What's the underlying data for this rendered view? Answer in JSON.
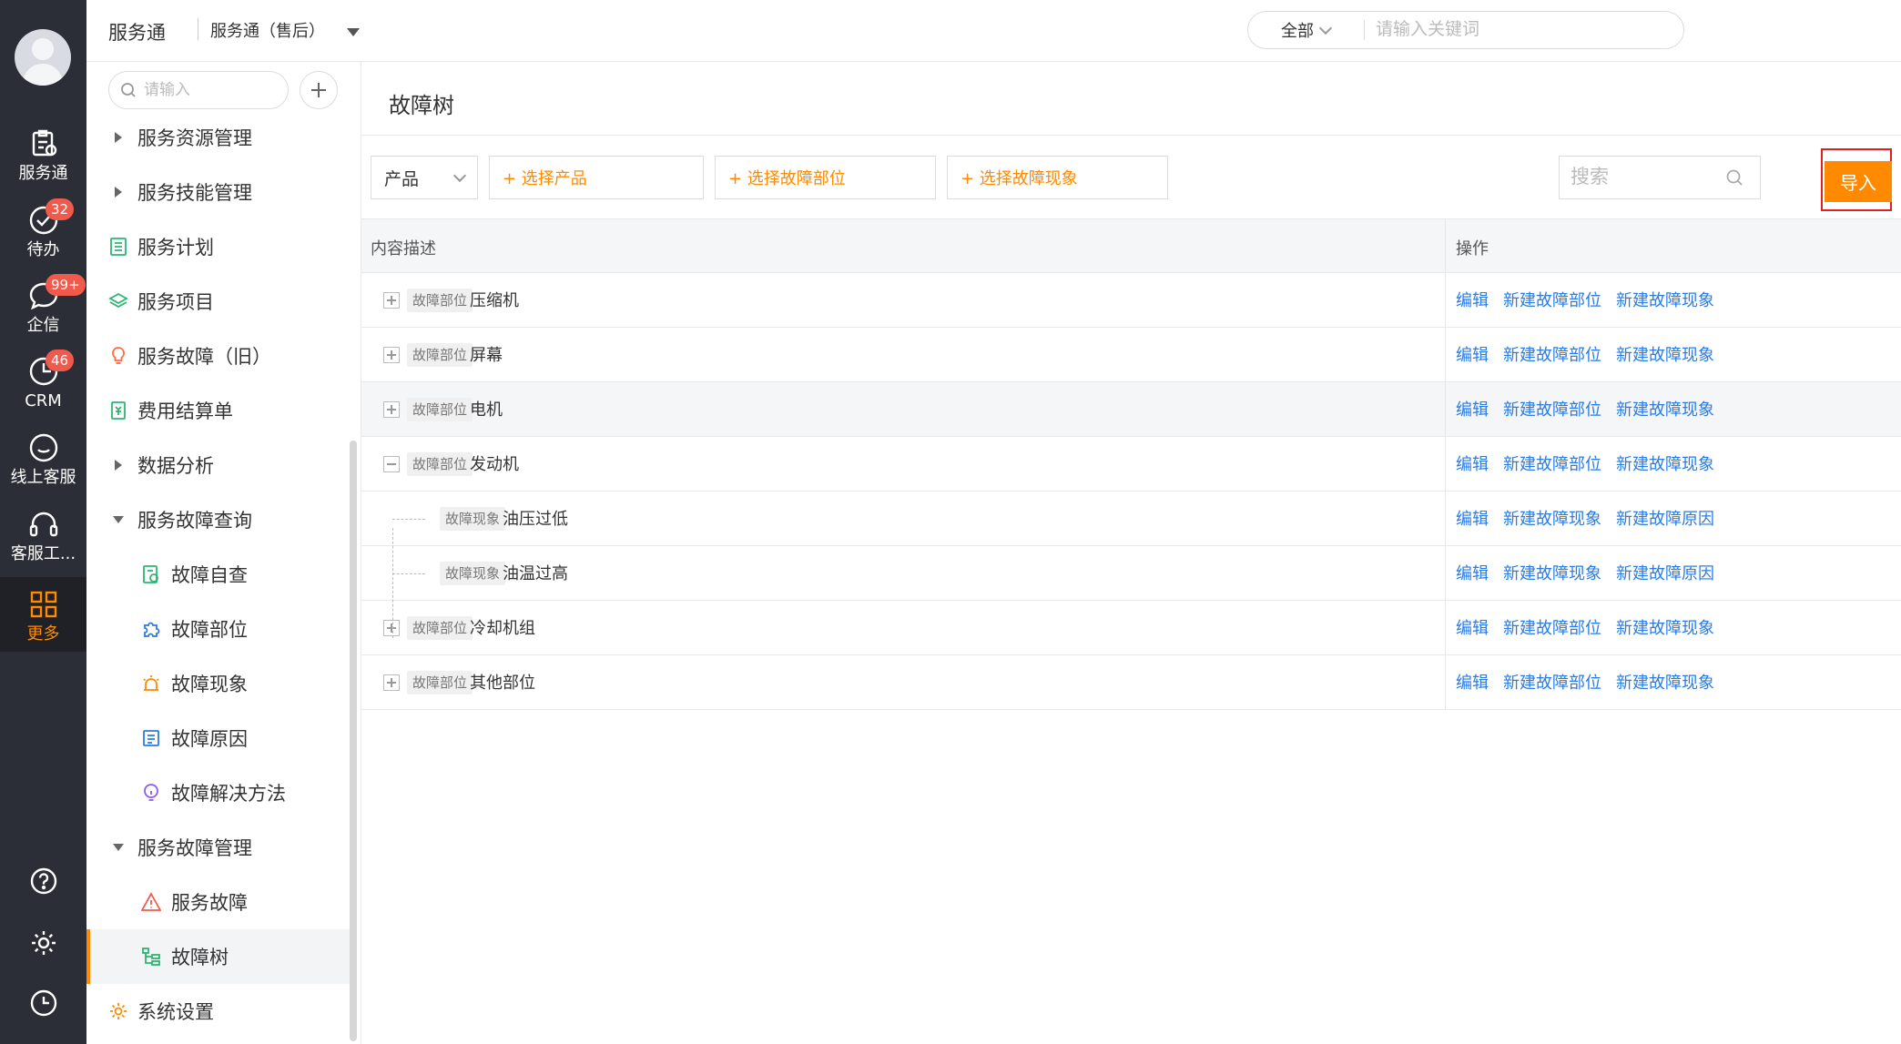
{
  "rail": {
    "items": [
      {
        "label": "服务通",
        "icon": "clipboard-icon"
      },
      {
        "label": "待办",
        "icon": "check-circle-icon",
        "badge": "32"
      },
      {
        "label": "企信",
        "icon": "chat-bubble-icon",
        "badge": "99+"
      },
      {
        "label": "CRM",
        "icon": "clock-chart-icon",
        "badge": "46"
      },
      {
        "label": "线上客服",
        "icon": "smile-chat-icon"
      },
      {
        "label": "客服工...",
        "icon": "headset-icon"
      },
      {
        "label": "更多",
        "icon": "grid-icon"
      }
    ],
    "bottom_icons": [
      "help-icon",
      "settings-icon",
      "history-icon"
    ]
  },
  "topbar": {
    "app_title": "服务通",
    "app_select": "服务通（售后）",
    "search_scope": "全部",
    "search_placeholder": "请输入关键词"
  },
  "subnav": {
    "search_placeholder": "请输入",
    "items": [
      {
        "label": "服务资源管理"
      },
      {
        "label": "服务技能管理"
      },
      {
        "label": "服务计划"
      },
      {
        "label": "服务项目"
      },
      {
        "label": "服务故障（旧）"
      },
      {
        "label": "费用结算单"
      },
      {
        "label": "数据分析"
      },
      {
        "label": "服务故障查询"
      },
      {
        "label": "故障自查"
      },
      {
        "label": "故障部位"
      },
      {
        "label": "故障现象"
      },
      {
        "label": "故障原因"
      },
      {
        "label": "故障解决方法"
      },
      {
        "label": "服务故障管理"
      },
      {
        "label": "服务故障"
      },
      {
        "label": "故障树"
      },
      {
        "label": "系统设置"
      }
    ]
  },
  "main": {
    "title": "故障树",
    "filter_select": "产品",
    "pick_product": "+ 选择产品",
    "pick_part": "+ 选择故障部位",
    "pick_phenomenon": "+ 选择故障现象",
    "search_placeholder": "搜索",
    "import_label": "导入",
    "col_desc": "内容描述",
    "col_ops": "操作",
    "rows": [
      {
        "tag": "故障部位",
        "name": "压缩机",
        "ops": [
          "编辑",
          "新建故障部位",
          "新建故障现象"
        ]
      },
      {
        "tag": "故障部位",
        "name": "屏幕",
        "ops": [
          "编辑",
          "新建故障部位",
          "新建故障现象"
        ]
      },
      {
        "tag": "故障部位",
        "name": "电机",
        "ops": [
          "编辑",
          "新建故障部位",
          "新建故障现象"
        ]
      },
      {
        "tag": "故障部位",
        "name": "发动机",
        "ops": [
          "编辑",
          "新建故障部位",
          "新建故障现象"
        ]
      },
      {
        "tag": "故障现象",
        "name": "油压过低",
        "ops": [
          "编辑",
          "新建故障现象",
          "新建故障原因"
        ]
      },
      {
        "tag": "故障现象",
        "name": "油温过高",
        "ops": [
          "编辑",
          "新建故障现象",
          "新建故障原因"
        ]
      },
      {
        "tag": "故障部位",
        "name": "冷却机组",
        "ops": [
          "编辑",
          "新建故障部位",
          "新建故障现象"
        ]
      },
      {
        "tag": "故障部位",
        "name": "其他部位",
        "ops": [
          "编辑",
          "新建故障部位",
          "新建故障现象"
        ]
      }
    ]
  },
  "colors": {
    "accent": "#ff8a00",
    "link": "#2a7be4",
    "rail": "#2b2e36",
    "badge": "#f05a4d",
    "highlight_box": "#e02020"
  }
}
